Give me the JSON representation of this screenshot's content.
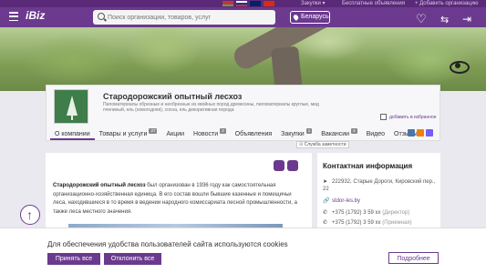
{
  "topbar": {
    "procurement_label": "Закупки ▾",
    "free_ads_label": "Бесплатные объявления",
    "add_org_label": "+ Добавить организацию"
  },
  "header": {
    "logo": "iBiz",
    "search_placeholder": "Поиск организации, товаров, услуг",
    "region": "Беларусь"
  },
  "company": {
    "name": "Стародорожский опытный лесхоз",
    "description": "Пиломатериалы обрезные и необрезные из хвойных пород древесины, пиломатериалы круглые, мед пчелиный, ель (новогодняя), сосна, ель декоративная порода",
    "favorite_label": "добавить в избранное",
    "service_link": "⊙ Служба заметности"
  },
  "tabs": [
    {
      "label": "О компании",
      "count": ""
    },
    {
      "label": "Товары и услуги",
      "count": "27"
    },
    {
      "label": "Акции",
      "count": ""
    },
    {
      "label": "Новости",
      "count": "3"
    },
    {
      "label": "Объявления",
      "count": ""
    },
    {
      "label": "Закупки",
      "count": "1"
    },
    {
      "label": "Вакансии",
      "count": "4"
    },
    {
      "label": "Видео",
      "count": ""
    },
    {
      "label": "Отзывы",
      "count": ""
    }
  ],
  "main": {
    "company_bold": "Стародорожский опытный лесхоз",
    "text": " был организован в 1936 году как самостоятельная организационно-хозяйственная единица. В его состав вошли бывшие казенные и помещичьи леса, находившиеся в то время в ведении народного комиссариата лесной промышленности, а также леса местного значения."
  },
  "contacts": {
    "title": "Контактная информация",
    "address": "222932, Старые Дороги, Кировский пер., 22",
    "website": "stdor-les.by",
    "phone1": "+375 (1792) 3 59 xx",
    "phone1_note": "(Директор)",
    "phone2": "+375 (1792) 3 59 xx",
    "phone2_note": "(Приемная)"
  },
  "cookie": {
    "message": "Для обеспечения удобства пользователей сайта используются cookies",
    "accept": "Принять все",
    "decline": "Отклонить все",
    "more": "Подробнее"
  },
  "colors": {
    "brand": "#6b3a8e",
    "header_bg": "#6b3a8e"
  }
}
